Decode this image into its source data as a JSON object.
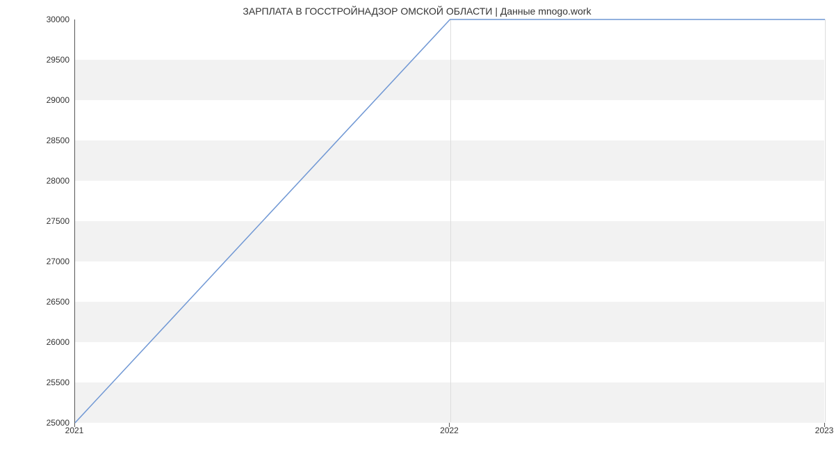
{
  "chart_data": {
    "type": "line",
    "title": "ЗАРПЛАТА В ГОССТРОЙНАДЗОР ОМСКОЙ ОБЛАСТИ | Данные mnogo.work",
    "xlabel": "",
    "ylabel": "",
    "x": [
      2021,
      2022,
      2023
    ],
    "values": [
      25000,
      30000,
      30000
    ],
    "x_ticks": [
      2021,
      2022,
      2023
    ],
    "y_ticks": [
      25000,
      25500,
      26000,
      26500,
      27000,
      27500,
      28000,
      28500,
      29000,
      29500,
      30000
    ],
    "xlim": [
      2021,
      2023
    ],
    "ylim": [
      25000,
      30000
    ],
    "line_color": "#6f97d4",
    "band_color": "#f2f2f2"
  }
}
